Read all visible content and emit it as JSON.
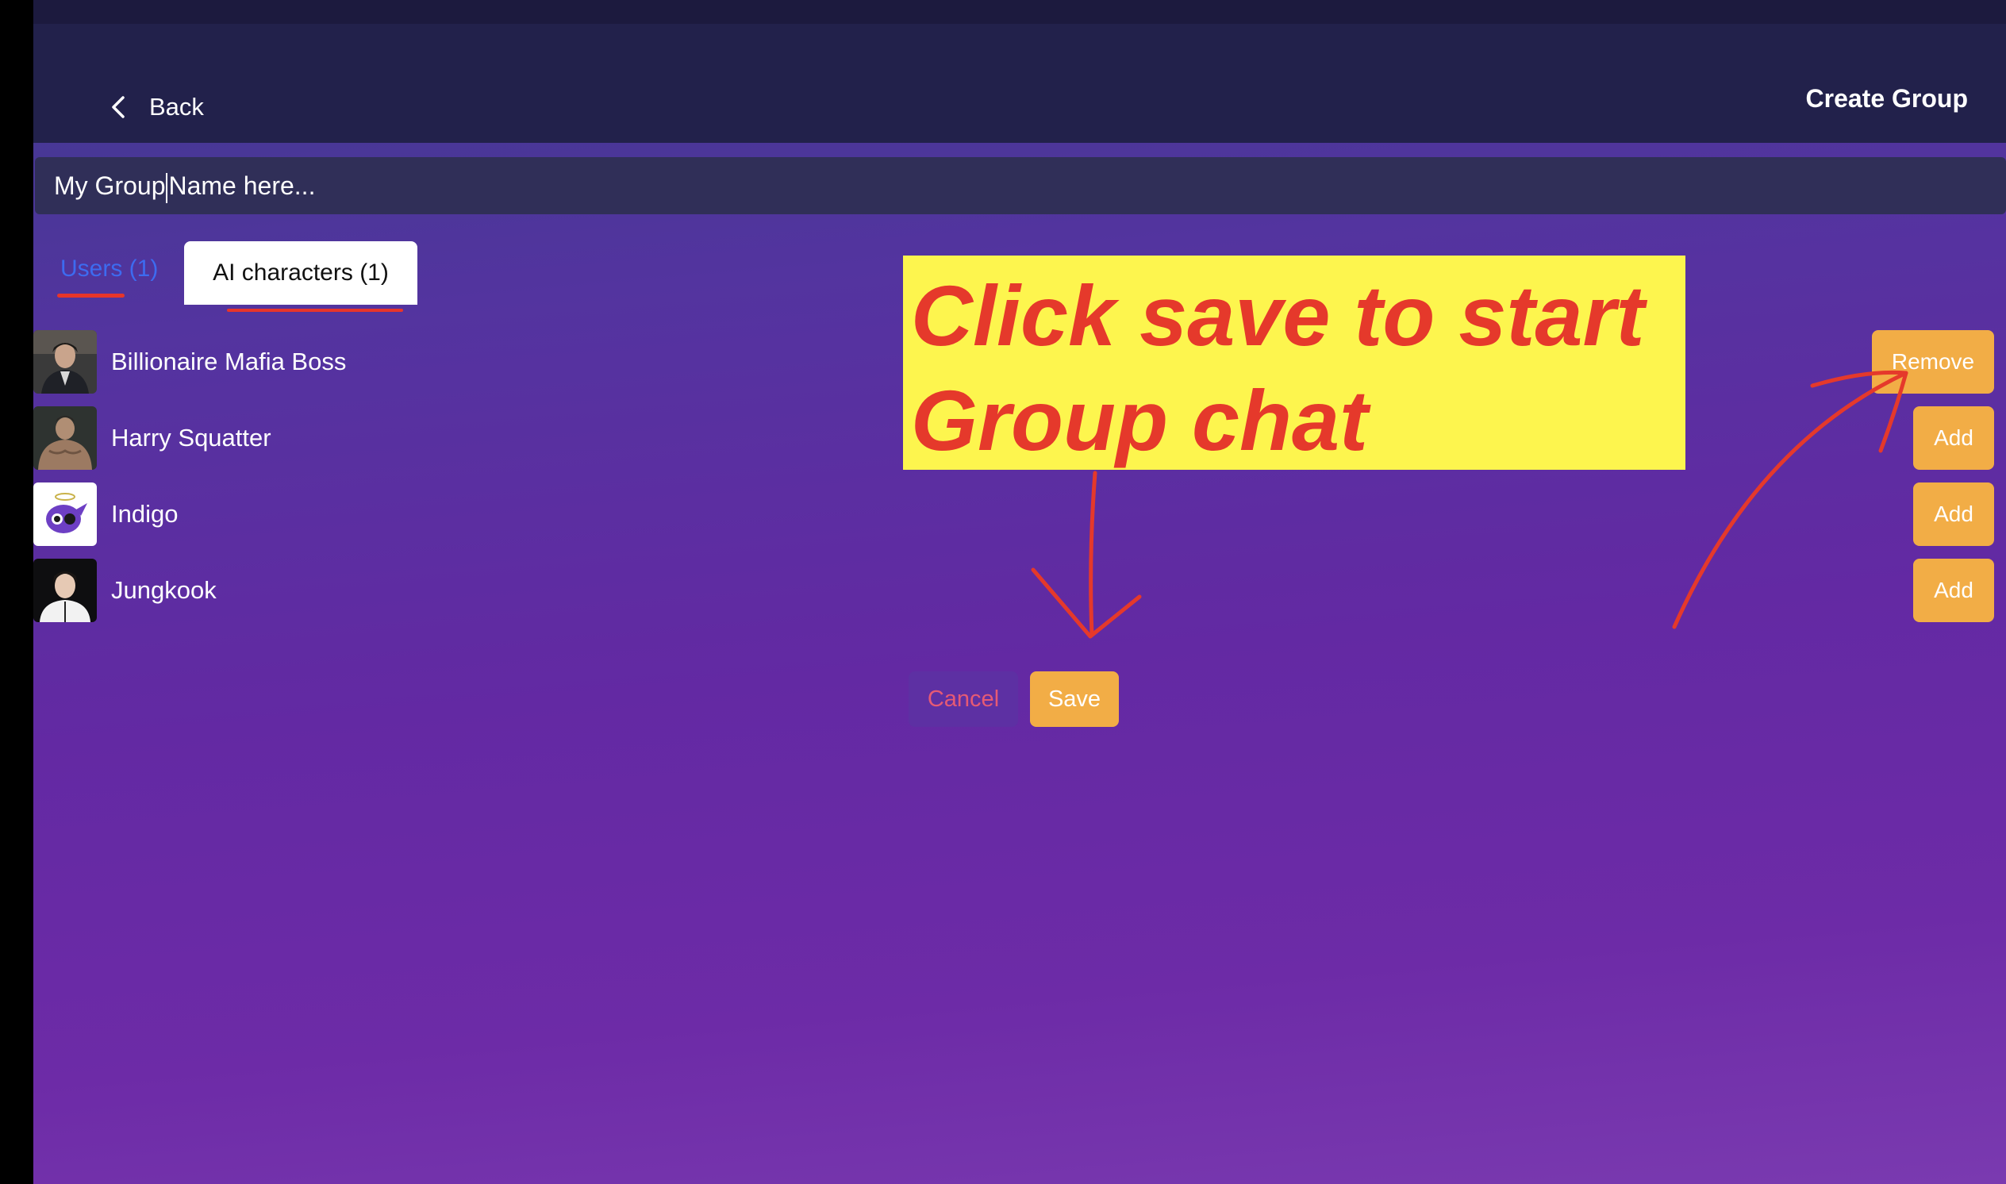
{
  "header": {
    "back_label": "Back",
    "title": "Create Group"
  },
  "group_name": {
    "value_before_caret": "My Group",
    "value_after_caret": "Name here..."
  },
  "tabs": [
    {
      "label": "Users (1)",
      "active": false
    },
    {
      "label": "AI characters (1)",
      "active": true
    }
  ],
  "characters": [
    {
      "name": "Billionaire Mafia Boss",
      "action": "Remove"
    },
    {
      "name": "Harry Squatter",
      "action": "Add"
    },
    {
      "name": "Indigo",
      "action": "Add"
    },
    {
      "name": "Jungkook",
      "action": "Add"
    }
  ],
  "buttons": {
    "cancel_label": "Cancel",
    "save_label": "Save"
  },
  "annotation": {
    "line1": "Click save to start",
    "line2": "Group chat"
  },
  "colors": {
    "accent": "#f2ad46",
    "link_blue": "#3d6bf0",
    "annotation_red": "#e5392b",
    "annotation_yellow": "#fdf54e"
  }
}
